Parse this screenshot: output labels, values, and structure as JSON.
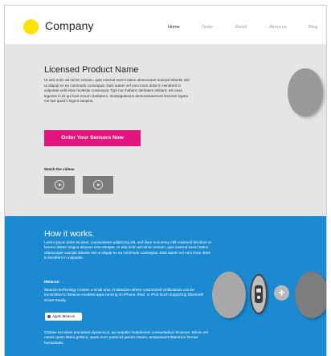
{
  "header": {
    "brand": "Company",
    "nav": [
      "Home",
      "Order",
      "Retail",
      "About us",
      "Blog"
    ],
    "active_nav": "Home",
    "logo_color": "#ffe400"
  },
  "hero": {
    "title": "Licensed Product Name",
    "text": "Ut wisi enim ad minim veniam, quis nostrud exerci tation ullamcorper suscipit lobortis nisl ut aliquip ex ea commodo consequat. Duis autem vel eum iriure dolor in hendrerit in vulputate velit esse molestie consequat. Typi non habent claritatem insitam; est usus legentis in iis qui facit eorum claritatem. Investigationes demonstraverunt lectores legere me lius quod ii legunt saepius.",
    "cta_label": "Order Your Sensors Now",
    "cta_color": "#e3147d",
    "videos_label": "Watch the videos",
    "background": "#e5e5e5"
  },
  "how": {
    "title": "How it works.",
    "text": "Lorem ipsum dolor sit amet, consectetuer adipiscing elit, sed diam nonummy nibh euismod tincidunt ut laoreet dolore magna aliquam erat volutpat. Ut wisi enim ad minim veniam, quis nostrud exerci tation ullamcorper suscipit lobortis nisl ut aliquip ex ea commodo consequat. Duis autem vel eum iriure dolor in hendrerit in vulputate.",
    "ibeacon_title": "iBeacon",
    "ibeacon_text": "iBeacon technology creates a small area of detection where customized notifications can be transmitted to iBeacon-enabled apps running on iPhone, iPad, or iPod touch supporting Bluetooth Smart Ready.",
    "ibeacon_badge": "Apple iBeacon",
    "text2": "Claritas est etiam processus dynamicus, qui sequitur mutationem consuetudium lectorum. Mirum est notare quam littera gothica, quam nunc putamus parum claram, anteposuerit litterarum formas humanitatis.",
    "plus": "+",
    "background": "#1c8ad0"
  }
}
